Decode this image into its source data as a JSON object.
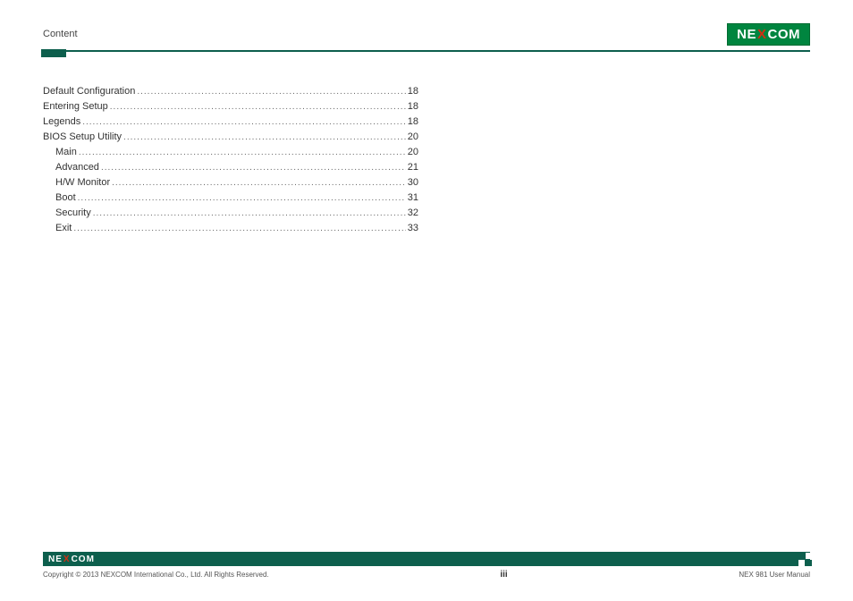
{
  "header": {
    "section_label": "Content",
    "logo_text_pre": "NE",
    "logo_text_x": "X",
    "logo_text_post": "COM"
  },
  "toc": [
    {
      "label": "Default Configuration",
      "page": "18",
      "indent": false
    },
    {
      "label": "Entering Setup",
      "page": "18",
      "indent": false
    },
    {
      "label": "Legends",
      "page": "18",
      "indent": false
    },
    {
      "label": "BIOS Setup Utility",
      "page": "20",
      "indent": false
    },
    {
      "label": "Main",
      "page": "20",
      "indent": true
    },
    {
      "label": "Advanced",
      "page": "21",
      "indent": true
    },
    {
      "label": "H/W Monitor",
      "page": "30",
      "indent": true
    },
    {
      "label": "Boot",
      "page": "31",
      "indent": true
    },
    {
      "label": "Security",
      "page": "32",
      "indent": true
    },
    {
      "label": "Exit",
      "page": "33",
      "indent": true
    }
  ],
  "footer": {
    "logo_pre": "NE",
    "logo_x": "X",
    "logo_post": "COM",
    "copyright": "Copyright © 2013 NEXCOM International Co., Ltd. All Rights Reserved.",
    "page_number": "iii",
    "doc_title": "NEX 981 User Manual"
  }
}
